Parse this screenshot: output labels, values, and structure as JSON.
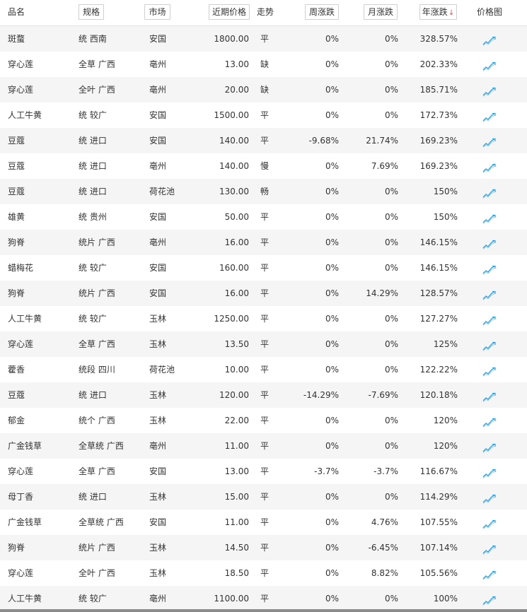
{
  "header": {
    "name": "品名",
    "spec": "规格",
    "market": "市场",
    "price": "近期价格",
    "trend": "走势",
    "week": "周涨跌",
    "month": "月涨跌",
    "year": "年涨跌",
    "chart": "价格图"
  },
  "sort": {
    "column": "year",
    "direction": "desc",
    "arrow": "↓"
  },
  "row_icon": "trend-line-chart-icon",
  "colors": {
    "row_stripe": "#f5f5f5",
    "icon": "#3aa3d8",
    "sort_arrow": "#e5484d"
  },
  "rows": [
    {
      "name": "斑蝥",
      "spec": "统 西南",
      "market": "安国",
      "price": "1800.00",
      "trend": "平",
      "week": "0%",
      "month": "0%",
      "year": "328.57%"
    },
    {
      "name": "穿心莲",
      "spec": "全草 广西",
      "market": "亳州",
      "price": "13.00",
      "trend": "缺",
      "week": "0%",
      "month": "0%",
      "year": "202.33%"
    },
    {
      "name": "穿心莲",
      "spec": "全叶 广西",
      "market": "亳州",
      "price": "20.00",
      "trend": "缺",
      "week": "0%",
      "month": "0%",
      "year": "185.71%"
    },
    {
      "name": "人工牛黄",
      "spec": "统 较广",
      "market": "安国",
      "price": "1500.00",
      "trend": "平",
      "week": "0%",
      "month": "0%",
      "year": "172.73%"
    },
    {
      "name": "豆蔻",
      "spec": "统 进口",
      "market": "安国",
      "price": "140.00",
      "trend": "平",
      "week": "-9.68%",
      "month": "21.74%",
      "year": "169.23%"
    },
    {
      "name": "豆蔻",
      "spec": "统 进口",
      "market": "亳州",
      "price": "140.00",
      "trend": "慢",
      "week": "0%",
      "month": "7.69%",
      "year": "169.23%"
    },
    {
      "name": "豆蔻",
      "spec": "统 进口",
      "market": "荷花池",
      "price": "130.00",
      "trend": "畅",
      "week": "0%",
      "month": "0%",
      "year": "150%"
    },
    {
      "name": "雄黄",
      "spec": "统 贵州",
      "market": "安国",
      "price": "50.00",
      "trend": "平",
      "week": "0%",
      "month": "0%",
      "year": "150%"
    },
    {
      "name": "狗脊",
      "spec": "统片 广西",
      "market": "亳州",
      "price": "16.00",
      "trend": "平",
      "week": "0%",
      "month": "0%",
      "year": "146.15%"
    },
    {
      "name": "蜡梅花",
      "spec": "统 较广",
      "market": "安国",
      "price": "160.00",
      "trend": "平",
      "week": "0%",
      "month": "0%",
      "year": "146.15%"
    },
    {
      "name": "狗脊",
      "spec": "统片 广西",
      "market": "安国",
      "price": "16.00",
      "trend": "平",
      "week": "0%",
      "month": "14.29%",
      "year": "128.57%"
    },
    {
      "name": "人工牛黄",
      "spec": "统 较广",
      "market": "玉林",
      "price": "1250.00",
      "trend": "平",
      "week": "0%",
      "month": "0%",
      "year": "127.27%"
    },
    {
      "name": "穿心莲",
      "spec": "全草 广西",
      "market": "玉林",
      "price": "13.50",
      "trend": "平",
      "week": "0%",
      "month": "0%",
      "year": "125%"
    },
    {
      "name": "藿香",
      "spec": "统段 四川",
      "market": "荷花池",
      "price": "10.00",
      "trend": "平",
      "week": "0%",
      "month": "0%",
      "year": "122.22%"
    },
    {
      "name": "豆蔻",
      "spec": "统 进口",
      "market": "玉林",
      "price": "120.00",
      "trend": "平",
      "week": "-14.29%",
      "month": "-7.69%",
      "year": "120.18%"
    },
    {
      "name": "郁金",
      "spec": "统个 广西",
      "market": "玉林",
      "price": "22.00",
      "trend": "平",
      "week": "0%",
      "month": "0%",
      "year": "120%"
    },
    {
      "name": "广金钱草",
      "spec": "全草统 广西",
      "market": "亳州",
      "price": "11.00",
      "trend": "平",
      "week": "0%",
      "month": "0%",
      "year": "120%"
    },
    {
      "name": "穿心莲",
      "spec": "全草 广西",
      "market": "安国",
      "price": "13.00",
      "trend": "平",
      "week": "-3.7%",
      "month": "-3.7%",
      "year": "116.67%"
    },
    {
      "name": "母丁香",
      "spec": "统 进口",
      "market": "玉林",
      "price": "15.00",
      "trend": "平",
      "week": "0%",
      "month": "0%",
      "year": "114.29%"
    },
    {
      "name": "广金钱草",
      "spec": "全草统 广西",
      "market": "安国",
      "price": "11.00",
      "trend": "平",
      "week": "0%",
      "month": "4.76%",
      "year": "107.55%"
    },
    {
      "name": "狗脊",
      "spec": "统片 广西",
      "market": "玉林",
      "price": "14.50",
      "trend": "平",
      "week": "0%",
      "month": "-6.45%",
      "year": "107.14%"
    },
    {
      "name": "穿心莲",
      "spec": "全叶 广西",
      "market": "玉林",
      "price": "18.50",
      "trend": "平",
      "week": "0%",
      "month": "8.82%",
      "year": "105.56%"
    },
    {
      "name": "人工牛黄",
      "spec": "统 较广",
      "market": "亳州",
      "price": "1100.00",
      "trend": "平",
      "week": "0%",
      "month": "0%",
      "year": "100%"
    }
  ]
}
